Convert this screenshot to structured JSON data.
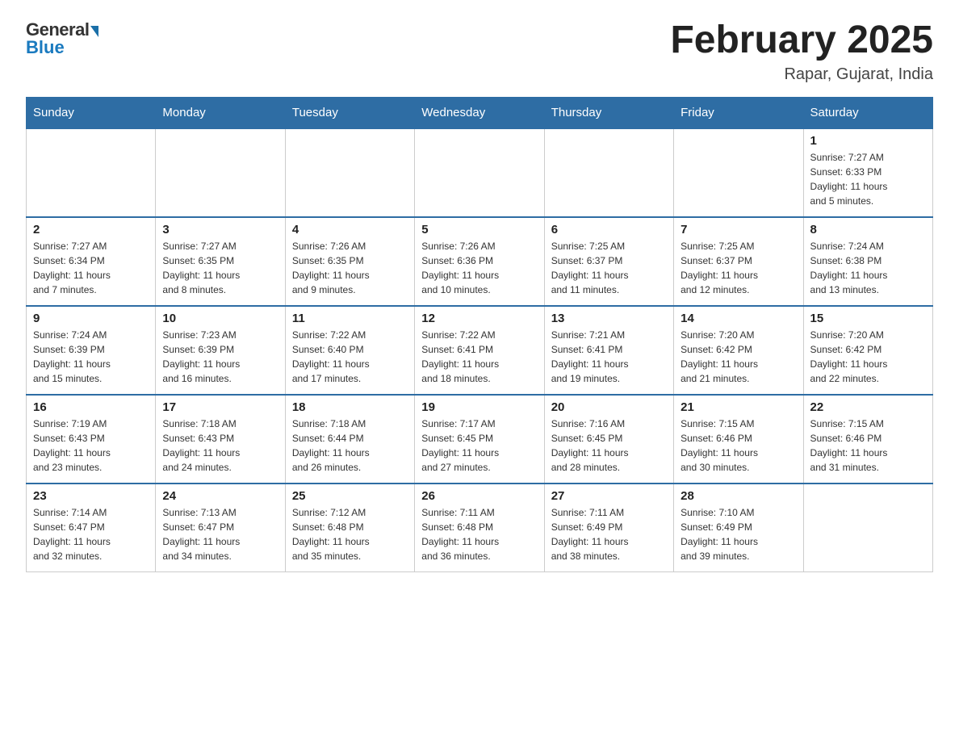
{
  "header": {
    "logo_general": "General",
    "logo_blue": "Blue",
    "month_title": "February 2025",
    "location": "Rapar, Gujarat, India"
  },
  "weekdays": [
    "Sunday",
    "Monday",
    "Tuesday",
    "Wednesday",
    "Thursday",
    "Friday",
    "Saturday"
  ],
  "weeks": [
    [
      {
        "day": "",
        "info": ""
      },
      {
        "day": "",
        "info": ""
      },
      {
        "day": "",
        "info": ""
      },
      {
        "day": "",
        "info": ""
      },
      {
        "day": "",
        "info": ""
      },
      {
        "day": "",
        "info": ""
      },
      {
        "day": "1",
        "info": "Sunrise: 7:27 AM\nSunset: 6:33 PM\nDaylight: 11 hours\nand 5 minutes."
      }
    ],
    [
      {
        "day": "2",
        "info": "Sunrise: 7:27 AM\nSunset: 6:34 PM\nDaylight: 11 hours\nand 7 minutes."
      },
      {
        "day": "3",
        "info": "Sunrise: 7:27 AM\nSunset: 6:35 PM\nDaylight: 11 hours\nand 8 minutes."
      },
      {
        "day": "4",
        "info": "Sunrise: 7:26 AM\nSunset: 6:35 PM\nDaylight: 11 hours\nand 9 minutes."
      },
      {
        "day": "5",
        "info": "Sunrise: 7:26 AM\nSunset: 6:36 PM\nDaylight: 11 hours\nand 10 minutes."
      },
      {
        "day": "6",
        "info": "Sunrise: 7:25 AM\nSunset: 6:37 PM\nDaylight: 11 hours\nand 11 minutes."
      },
      {
        "day": "7",
        "info": "Sunrise: 7:25 AM\nSunset: 6:37 PM\nDaylight: 11 hours\nand 12 minutes."
      },
      {
        "day": "8",
        "info": "Sunrise: 7:24 AM\nSunset: 6:38 PM\nDaylight: 11 hours\nand 13 minutes."
      }
    ],
    [
      {
        "day": "9",
        "info": "Sunrise: 7:24 AM\nSunset: 6:39 PM\nDaylight: 11 hours\nand 15 minutes."
      },
      {
        "day": "10",
        "info": "Sunrise: 7:23 AM\nSunset: 6:39 PM\nDaylight: 11 hours\nand 16 minutes."
      },
      {
        "day": "11",
        "info": "Sunrise: 7:22 AM\nSunset: 6:40 PM\nDaylight: 11 hours\nand 17 minutes."
      },
      {
        "day": "12",
        "info": "Sunrise: 7:22 AM\nSunset: 6:41 PM\nDaylight: 11 hours\nand 18 minutes."
      },
      {
        "day": "13",
        "info": "Sunrise: 7:21 AM\nSunset: 6:41 PM\nDaylight: 11 hours\nand 19 minutes."
      },
      {
        "day": "14",
        "info": "Sunrise: 7:20 AM\nSunset: 6:42 PM\nDaylight: 11 hours\nand 21 minutes."
      },
      {
        "day": "15",
        "info": "Sunrise: 7:20 AM\nSunset: 6:42 PM\nDaylight: 11 hours\nand 22 minutes."
      }
    ],
    [
      {
        "day": "16",
        "info": "Sunrise: 7:19 AM\nSunset: 6:43 PM\nDaylight: 11 hours\nand 23 minutes."
      },
      {
        "day": "17",
        "info": "Sunrise: 7:18 AM\nSunset: 6:43 PM\nDaylight: 11 hours\nand 24 minutes."
      },
      {
        "day": "18",
        "info": "Sunrise: 7:18 AM\nSunset: 6:44 PM\nDaylight: 11 hours\nand 26 minutes."
      },
      {
        "day": "19",
        "info": "Sunrise: 7:17 AM\nSunset: 6:45 PM\nDaylight: 11 hours\nand 27 minutes."
      },
      {
        "day": "20",
        "info": "Sunrise: 7:16 AM\nSunset: 6:45 PM\nDaylight: 11 hours\nand 28 minutes."
      },
      {
        "day": "21",
        "info": "Sunrise: 7:15 AM\nSunset: 6:46 PM\nDaylight: 11 hours\nand 30 minutes."
      },
      {
        "day": "22",
        "info": "Sunrise: 7:15 AM\nSunset: 6:46 PM\nDaylight: 11 hours\nand 31 minutes."
      }
    ],
    [
      {
        "day": "23",
        "info": "Sunrise: 7:14 AM\nSunset: 6:47 PM\nDaylight: 11 hours\nand 32 minutes."
      },
      {
        "day": "24",
        "info": "Sunrise: 7:13 AM\nSunset: 6:47 PM\nDaylight: 11 hours\nand 34 minutes."
      },
      {
        "day": "25",
        "info": "Sunrise: 7:12 AM\nSunset: 6:48 PM\nDaylight: 11 hours\nand 35 minutes."
      },
      {
        "day": "26",
        "info": "Sunrise: 7:11 AM\nSunset: 6:48 PM\nDaylight: 11 hours\nand 36 minutes."
      },
      {
        "day": "27",
        "info": "Sunrise: 7:11 AM\nSunset: 6:49 PM\nDaylight: 11 hours\nand 38 minutes."
      },
      {
        "day": "28",
        "info": "Sunrise: 7:10 AM\nSunset: 6:49 PM\nDaylight: 11 hours\nand 39 minutes."
      },
      {
        "day": "",
        "info": ""
      }
    ]
  ]
}
